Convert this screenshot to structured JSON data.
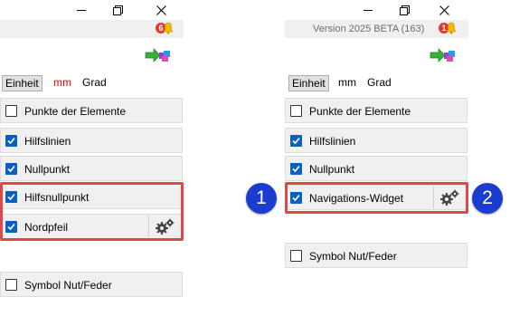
{
  "left_panel": {
    "badge_count": "6",
    "units": [
      "Einheit",
      "mm",
      "Grad"
    ],
    "rows": [
      {
        "label": "Punkte der Elemente",
        "checked": false
      },
      {
        "label": "Hilfslinien",
        "checked": true
      },
      {
        "label": "Nullpunkt",
        "checked": true
      },
      {
        "label": "Hilfsnullpunkt",
        "checked": true
      },
      {
        "label": "Nordpfeil",
        "checked": true
      },
      {
        "label": "Symbol Nut/Feder",
        "checked": false
      }
    ]
  },
  "right_panel": {
    "version_text": "Version 2025 BETA  (163)",
    "badge_count": "1",
    "units": [
      "Einheit",
      "mm",
      "Grad"
    ],
    "rows": [
      {
        "label": "Punkte der Elemente",
        "checked": false
      },
      {
        "label": "Hilfslinien",
        "checked": true
      },
      {
        "label": "Nullpunkt",
        "checked": true
      },
      {
        "label": "Navigations-Widget",
        "checked": true
      },
      {
        "label": "Symbol Nut/Feder",
        "checked": false
      }
    ]
  },
  "callouts": [
    "1",
    "2"
  ],
  "colors": {
    "accent": "#0a5fc2",
    "highlight": "#e0474c",
    "callout": "#1a3ccf",
    "unit_red": "#e60000"
  },
  "icons": [
    "minimize-icon",
    "maximize-icon",
    "close-icon",
    "notification-bell-icon",
    "layers-arrow-icon",
    "gear-icon"
  ]
}
